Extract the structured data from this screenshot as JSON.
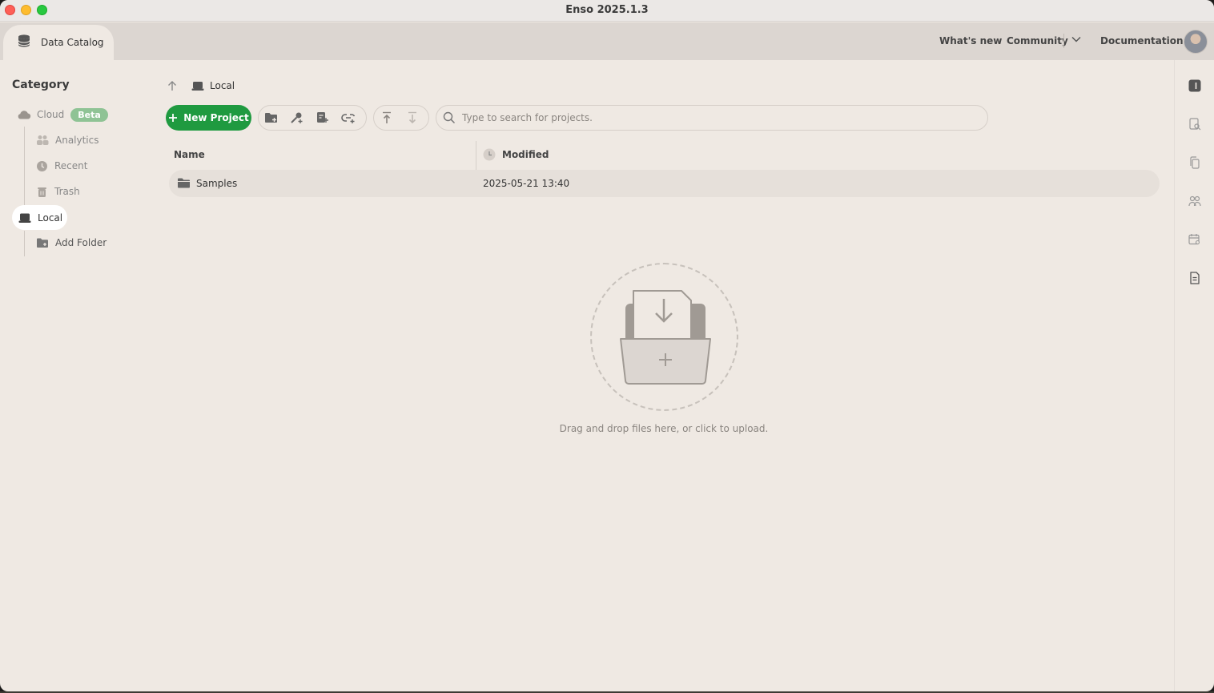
{
  "window": {
    "title": "Enso 2025.1.3"
  },
  "tabs": {
    "active_label": "Data Catalog"
  },
  "topnav": {
    "whats_new": "What's new",
    "community": "Community",
    "documentation": "Documentation"
  },
  "sidebar": {
    "title": "Category",
    "cloud": {
      "label": "Cloud",
      "badge": "Beta"
    },
    "items": [
      {
        "label": "Analytics",
        "icon": "people-icon"
      },
      {
        "label": "Recent",
        "icon": "clock-icon"
      },
      {
        "label": "Trash",
        "icon": "trash-icon"
      }
    ],
    "local": "Local",
    "add_folder": "Add Folder"
  },
  "breadcrumb": {
    "location": "Local"
  },
  "toolbar": {
    "new_project": "New Project",
    "search_placeholder": "Type to search for projects."
  },
  "table": {
    "columns": [
      "Name",
      "Modified"
    ],
    "rows": [
      {
        "name": "Samples",
        "modified": "2025-05-21 13:40"
      }
    ]
  },
  "dropzone": {
    "text": "Drag and drop files here, or click to upload."
  },
  "colors": {
    "accent_green": "#1f9a40",
    "background": "#efe9e3",
    "badge_green": "#8fc395"
  }
}
